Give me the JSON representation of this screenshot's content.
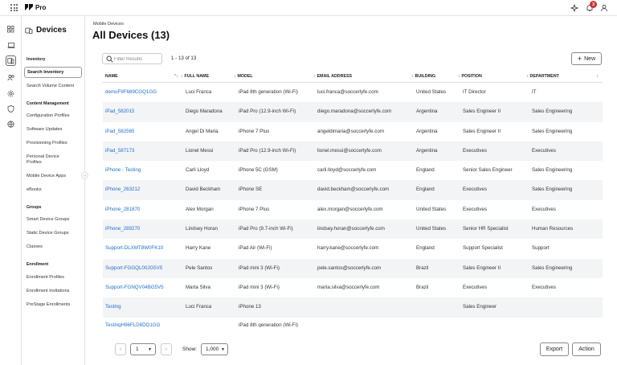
{
  "app": {
    "brand": "Pro",
    "notification_count": "3"
  },
  "sidenav": {
    "title": "Devices",
    "sections": [
      {
        "label": "Inventory",
        "items": [
          {
            "label": "Search Inventory",
            "selected": true
          },
          {
            "label": "Search Volume Content"
          }
        ]
      },
      {
        "label": "Content Management",
        "items": [
          {
            "label": "Configuration Profiles"
          },
          {
            "label": "Software Updates"
          },
          {
            "label": "Provisioning Profiles"
          },
          {
            "label": "Personal Device Profiles"
          },
          {
            "label": "Mobile Device Apps"
          },
          {
            "label": "eBooks"
          }
        ]
      },
      {
        "label": "Groups",
        "items": [
          {
            "label": "Smart Device Groups"
          },
          {
            "label": "Static Device Groups"
          },
          {
            "label": "Classes"
          }
        ]
      },
      {
        "label": "Enrollment",
        "items": [
          {
            "label": "Enrollment Profiles"
          },
          {
            "label": "Enrollment Invitations"
          },
          {
            "label": "PreStage Enrollments"
          }
        ]
      }
    ]
  },
  "header": {
    "breadcrumb": "Mobile Devices",
    "title": "All Devices (13)"
  },
  "toolbar": {
    "search_placeholder": "Filter Results",
    "count": "1 - 13 of 13",
    "new_label": "New"
  },
  "table": {
    "columns": [
      "NAME",
      "FULL NAME",
      "MODEL",
      "EMAIL ADDRESS",
      "BUILDING",
      "POSITION",
      "DEPARTMENT"
    ],
    "rows": [
      [
        "demoF9F689CGQ1GG",
        "Luci Franca",
        "iPad 8th generation (Wi-Fi)",
        "luci.franca@soccerlyfe.com",
        "United States",
        "IT Director",
        "IT"
      ],
      [
        "iPad_582015",
        "Diego Maradona",
        "iPad Pro (12.9-inch Wi-Fi)",
        "diego.maradona@soccerlyfe.com",
        "Argentina",
        "Sales Engineer II",
        "Sales Engineering"
      ],
      [
        "iPad_582565",
        "Angel Di Maria",
        "iPhone 7 Plus",
        "angeldimaria@soccerlyfe.com",
        "Argentina",
        "Sales Engineer II",
        "Sales Engineering"
      ],
      [
        "iPad_587173",
        "Lionel Messi",
        "iPad Pro (12.9-inch Wi-Fi)",
        "lionel.messi@soccerlyfe.com",
        "Argentina",
        "Executives",
        "Executives"
      ],
      [
        "iPhone - Testing",
        "Carli Lloyd",
        "iPhone 5C (GSM)",
        "carli.lloyd@soccerlyfe.com",
        "England",
        "Senior Sales Engineer",
        "Sales Engineering"
      ],
      [
        "iPhone_263212",
        "David Beckham",
        "iPhone SE",
        "david.beckham@soccerlyfe.com",
        "England",
        "Executives",
        "Sales Engineering"
      ],
      [
        "iPhone_281870",
        "Alex Morgan",
        "iPhone 7 Plus",
        "alex.morgan@soccerlyfe.com",
        "United States",
        "Executives",
        "Executives"
      ],
      [
        "iPhone_289270",
        "Lindsey Horan",
        "iPad Pro (9.7-inch Wi-Fi)",
        "lindsey.horan@soccerlyfe.com",
        "United States",
        "Senior HR Specialist",
        "Human Resources"
      ],
      [
        "Support-DLXMT8W0FK10",
        "Harry Kane",
        "iPad Air (Wi-Fi)",
        "harry.kane@soccerlyfe.com",
        "England",
        "Support Specialist",
        "Support"
      ],
      [
        "Support-FGGQL00JG5V5",
        "Pele Santos",
        "iPad mini 3 (Wi-Fi)",
        "pele.santos@soccerlyfe.com",
        "Brazil",
        "Sales Engineer II",
        "Sales Engineering"
      ],
      [
        "Support-FGNQV04BG5V5",
        "Marta Silva",
        "iPad mini 3 (Wi-Fi)",
        "marta.silva@soccerlyfe.com",
        "Brazil",
        "Executives",
        "Executives"
      ],
      [
        "Testing",
        "Luci Franca",
        "iPhone 13",
        "",
        "",
        "Sales Engineer",
        ""
      ],
      [
        "TestingH96FLD8DQ1GG",
        "",
        "iPad 8th generation (Wi-Fi)",
        "",
        "",
        "",
        ""
      ]
    ]
  },
  "footer": {
    "page": "1",
    "show_label": "Show:",
    "show_value": "1,000",
    "export_label": "Export",
    "action_label": "Action"
  }
}
